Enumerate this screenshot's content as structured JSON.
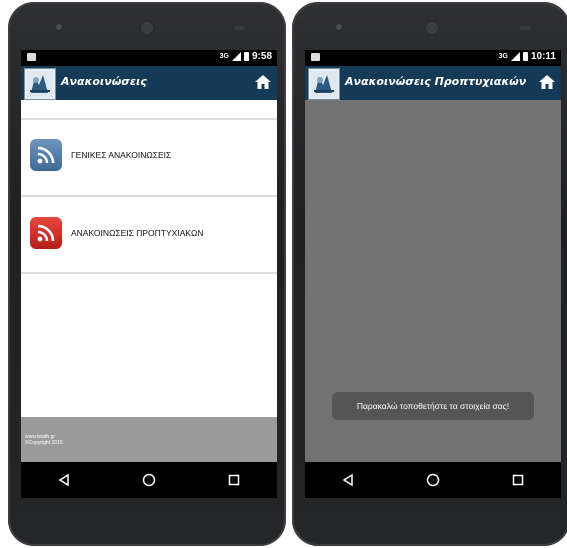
{
  "left_phone": {
    "status_time": "9:58",
    "status_network": "3G",
    "app_title": "Ανακοινώσεις",
    "feeds": [
      {
        "label": "ΓΕΝΙΚΕΣ ΑΝΑΚΟΙΝΩΣΕΙΣ",
        "icon": "rss-icon",
        "color": "#4f7aa6"
      },
      {
        "label": "ΑΝΑΚΟΙΝΩΣΕΙΣ ΠΡΟΠΤΥΧΙΑΚΩΝ",
        "icon": "rss-icon",
        "color": "#d0322b"
      }
    ],
    "footer_line1": "www.teiath.gr",
    "footer_line2": "©Copyright 2015"
  },
  "right_phone": {
    "status_time": "10:11",
    "status_network": "3G",
    "app_title": "Ανακοινώσεις Προπτυχιακών",
    "toast_message": "Παρακαλώ τοποθετήστε τα στοιχεία σας!"
  },
  "colors": {
    "appbar": "#153a57",
    "statusbar": "#000000",
    "overlay_gray": "#737373",
    "footer_gray": "#9a9a9a"
  },
  "icons": {
    "home": "home-icon",
    "back": "back-triangle-icon",
    "home_nav": "home-circle-icon",
    "recents": "recents-square-icon",
    "logo": "university-logo-icon"
  }
}
